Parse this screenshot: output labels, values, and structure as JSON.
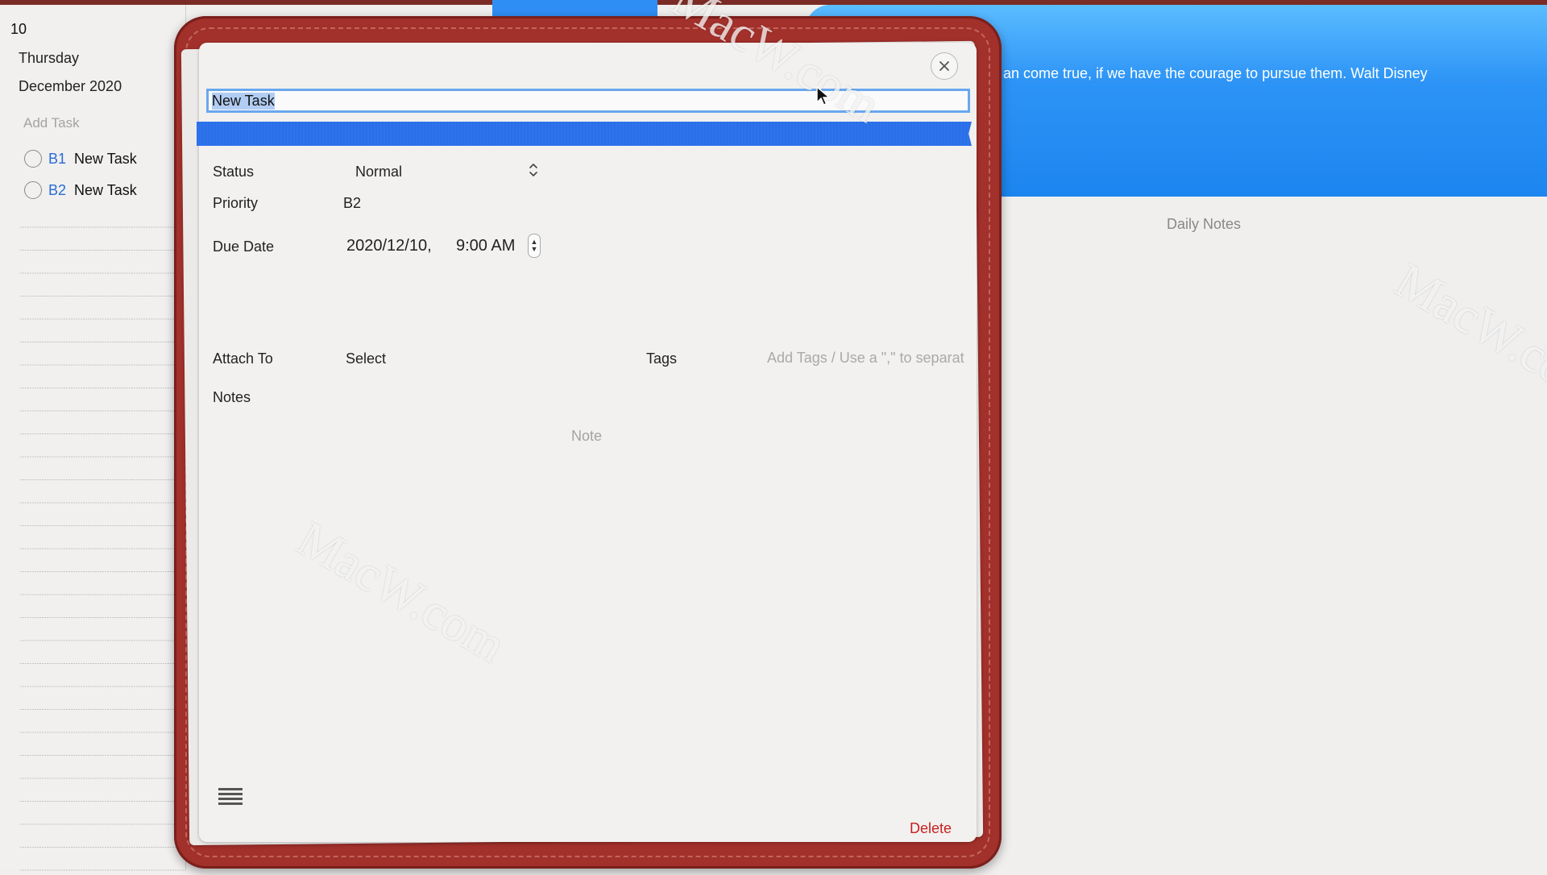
{
  "planner": {
    "day_number": "10",
    "weekday": "Thursday",
    "month_year": "December 2020",
    "add_task_placeholder": "Add Task",
    "tasks": [
      {
        "priority": "B1",
        "title": "New Task"
      },
      {
        "priority": "B2",
        "title": "New Task"
      }
    ]
  },
  "right_panel": {
    "quote": "an come true, if we have the courage to pursue them. Walt Disney",
    "daily_notes_label": "Daily Notes"
  },
  "watermarks": [
    "MacW.com",
    "MacW.com",
    "MacW.com"
  ],
  "task_editor": {
    "title_value": "New Task",
    "status_label": "Status",
    "status_value": "Normal",
    "priority_label": "Priority",
    "priority_value": "B2",
    "due_date_label": "Due Date",
    "due_date_value": "2020/12/10,",
    "due_time_value": "9:00 AM",
    "attach_label": "Attach To",
    "attach_value": "Select",
    "tags_label": "Tags",
    "tags_placeholder": "Add Tags / Use a \",\" to separat",
    "notes_label": "Notes",
    "note_placeholder": "Note",
    "delete_label": "Delete",
    "icons": {
      "close": "close-icon",
      "menu": "menu-icon",
      "status_arrows": "chevron-updown-icon"
    }
  },
  "colors": {
    "folder_red": "#a2302b",
    "accent_blue": "#2f73ec",
    "delete_red": "#c82020",
    "priority_blue": "#2a6bd6"
  }
}
